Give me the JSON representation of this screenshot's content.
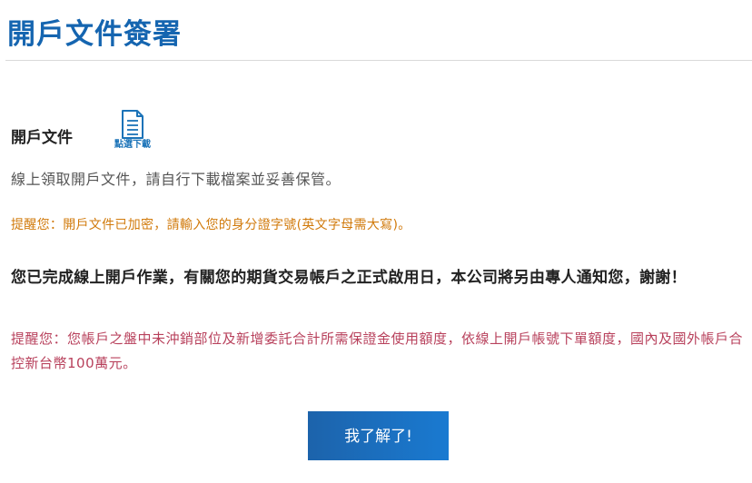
{
  "header": {
    "title": "開戶文件簽署"
  },
  "documents": {
    "label": "開戶文件",
    "download_icon": "document-icon",
    "download_label": "點選下載",
    "description": "線上領取開戶文件，請自行下載檔案並妥善保管。",
    "password_reminder": "提醒您：開戶文件已加密，請輸入您的身分證字號(英文字母需大寫)。"
  },
  "notice": {
    "completion_message": "您已完成線上開戶作業，有關您的期貨交易帳戶之正式啟用日，本公司將另由專人通知您，謝謝！",
    "limit_reminder": "提醒您：您帳戶之盤中未沖銷部位及新增委託合計所需保證金使用額度，依線上開戶帳號下單額度，國內及國外帳戶合控新台幣100萬元。"
  },
  "actions": {
    "confirm_label": "我了解了!"
  },
  "colors": {
    "title": "#1565b0",
    "warning_orange": "#d17a0b",
    "warning_red": "#b8415c",
    "button": "#1a6fc0"
  }
}
